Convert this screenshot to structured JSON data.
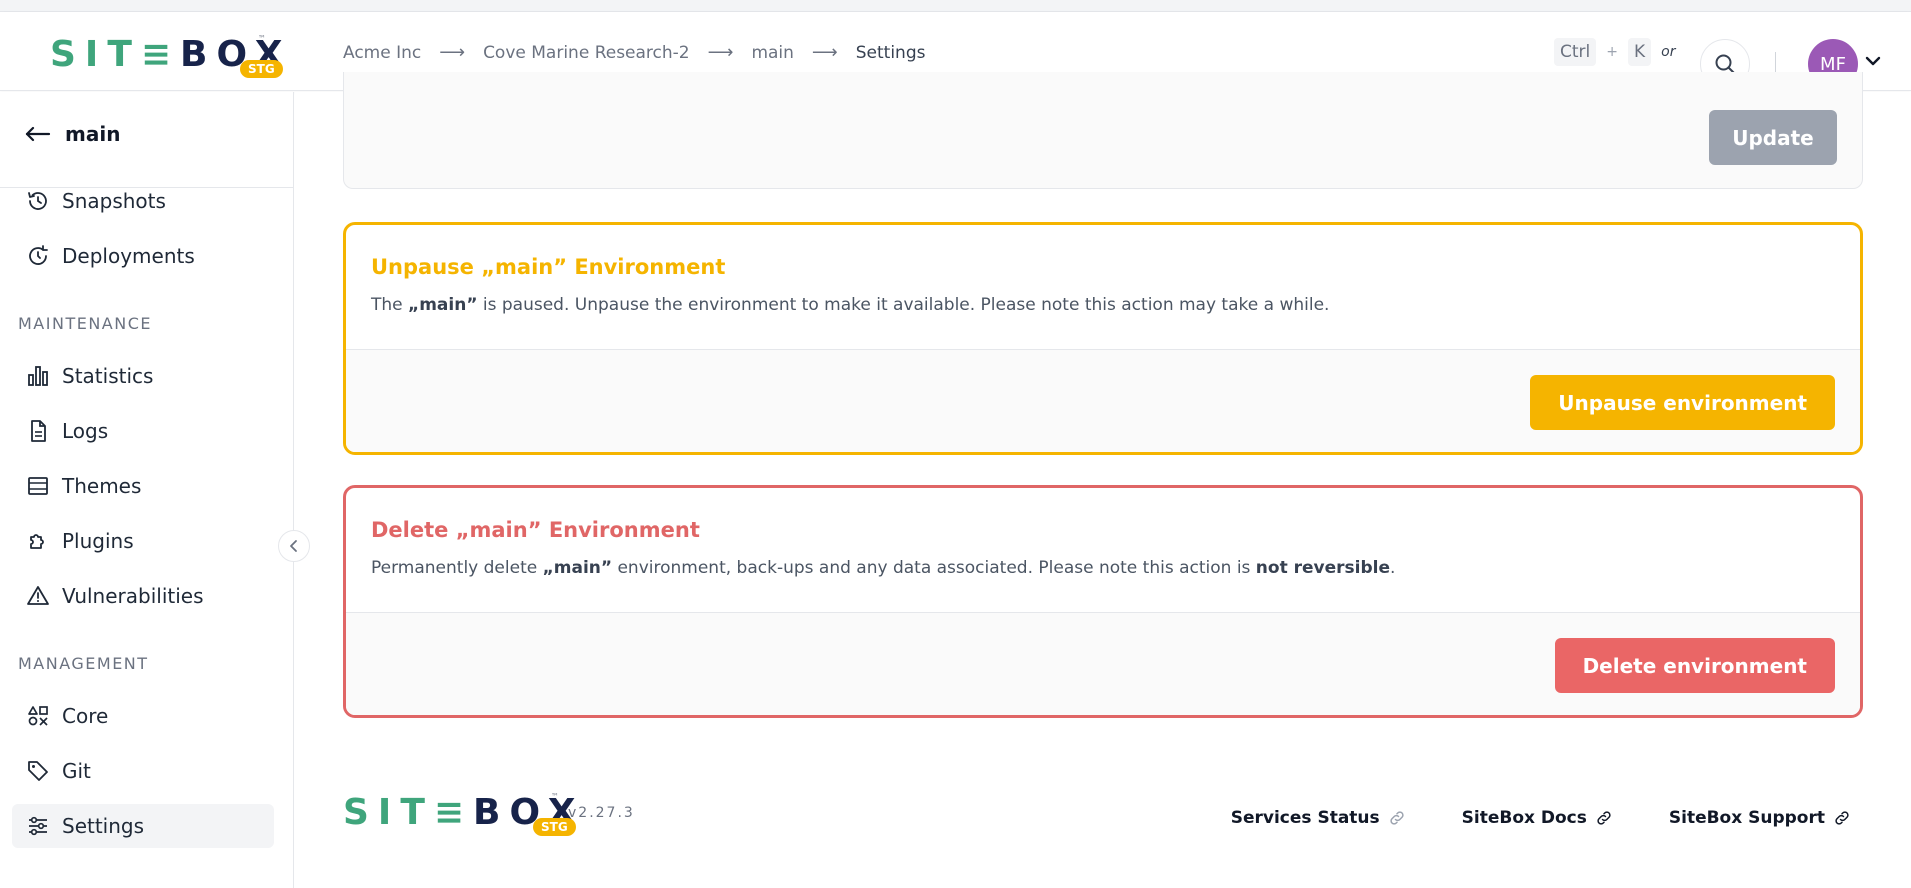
{
  "brand": {
    "name_part1": "SIT≡",
    "name_part2": "BOX",
    "tm": "™",
    "env_badge": "STG",
    "colors": {
      "green": "#3fa57c",
      "navy": "#17234a",
      "badge": "#f5b400"
    }
  },
  "breadcrumb": [
    {
      "label": "Acme Inc"
    },
    {
      "label": "Cove Marine Research-2"
    },
    {
      "label": "main"
    },
    {
      "label": "Settings"
    }
  ],
  "shortcut": {
    "key1": "Ctrl",
    "plus": "+",
    "key2": "K",
    "or": "or"
  },
  "user": {
    "initials": "MF",
    "avatar_color": "#9b59b6"
  },
  "sidebar": {
    "back_label": "main",
    "top_items": [
      {
        "label": "Snapshots",
        "icon": "history-icon"
      },
      {
        "label": "Deployments",
        "icon": "deploy-icon"
      }
    ],
    "maintenance_label": "MAINTENANCE",
    "maintenance_items": [
      {
        "label": "Statistics",
        "icon": "bar-chart-icon"
      },
      {
        "label": "Logs",
        "icon": "document-icon"
      },
      {
        "label": "Themes",
        "icon": "themes-icon"
      },
      {
        "label": "Plugins",
        "icon": "puzzle-icon"
      },
      {
        "label": "Vulnerabilities",
        "icon": "warning-icon"
      }
    ],
    "management_label": "MANAGEMENT",
    "management_items": [
      {
        "label": "Core",
        "icon": "shapes-icon"
      },
      {
        "label": "Git",
        "icon": "tag-icon"
      },
      {
        "label": "Settings",
        "icon": "sliders-icon",
        "active": true
      }
    ]
  },
  "main": {
    "update_label": "Update",
    "unpause": {
      "title": "Unpause „main” Environment",
      "desc_pre": "The ",
      "desc_bold": "„main”",
      "desc_post": " is paused. Unpause the environment to make it available. Please note this action may take a while.",
      "button": "Unpause environment",
      "color": "#f5b400"
    },
    "delete": {
      "title": "Delete „main” Environment",
      "desc_pre": "Permanently delete ",
      "desc_bold": "„main”",
      "desc_mid": " environment, back-ups and any data associated. Please note this action is ",
      "desc_bold2": "not reversible",
      "desc_end": ".",
      "button": "Delete environment",
      "color": "#ea6666"
    }
  },
  "footer": {
    "version": "v2.27.3",
    "links": [
      {
        "label": "Services Status",
        "icon": "link-icon"
      },
      {
        "label": "SiteBox Docs",
        "icon": "link-icon"
      },
      {
        "label": "SiteBox Support",
        "icon": "link-icon"
      }
    ]
  }
}
